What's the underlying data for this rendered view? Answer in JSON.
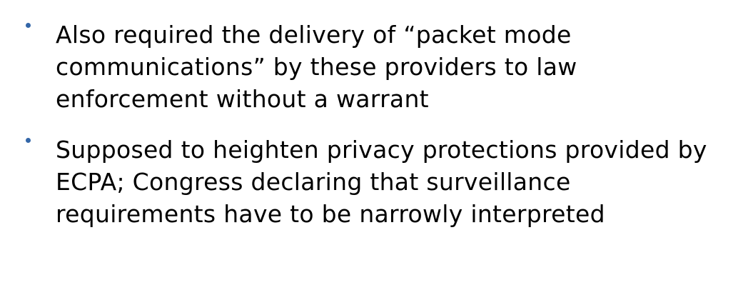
{
  "bullets": [
    {
      "text": "Also required the delivery of “packet mode communications” by these providers to law enforcement without a warrant"
    },
    {
      "text": "Supposed to heighten privacy protections provided by ECPA; Congress declaring that surveillance requirements have to be narrowly interpreted"
    }
  ],
  "colors": {
    "bullet": "#3366a8",
    "text": "#000000",
    "background": "#ffffff"
  }
}
